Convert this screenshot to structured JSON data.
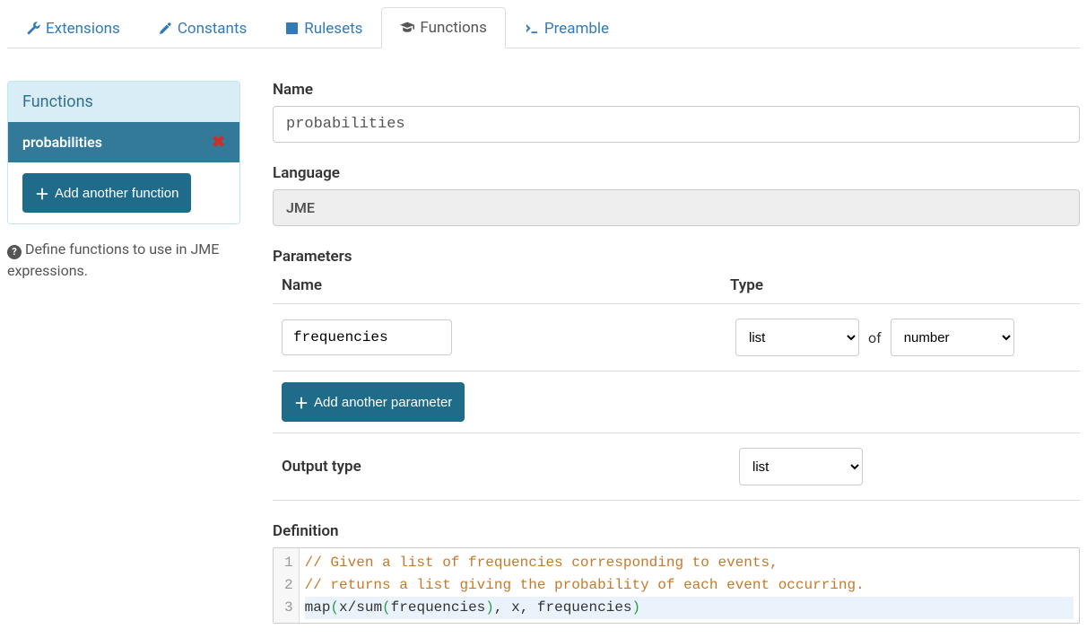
{
  "tabs": {
    "extensions": "Extensions",
    "constants": "Constants",
    "rulesets": "Rulesets",
    "functions": "Functions",
    "preamble": "Preamble"
  },
  "sidebar": {
    "panel_title": "Functions",
    "items": [
      {
        "name": "probabilities"
      }
    ],
    "add_button": "Add another function",
    "help_text": "Define functions to use in JME expressions."
  },
  "form": {
    "name_label": "Name",
    "name_value": "probabilities",
    "language_label": "Language",
    "language_value": "JME",
    "parameters_label": "Parameters",
    "param_header_name": "Name",
    "param_header_type": "Type",
    "parameters": [
      {
        "name": "frequencies",
        "type": "list",
        "of_word": "of",
        "subtype": "number"
      }
    ],
    "add_param_button": "Add another parameter",
    "output_type_label": "Output type",
    "output_type_value": "list",
    "definition_label": "Definition",
    "code": {
      "line1": "// Given a list of frequencies corresponding to events,",
      "line2": "// returns a list giving the probability of each event occurring.",
      "line3": {
        "t1": "map",
        "p1": "(",
        "t2": "x/sum",
        "p2": "(",
        "t3": "frequencies",
        "p3": ")",
        "t4": ", x, frequencies",
        "p4": ")"
      },
      "gutter": [
        "1",
        "2",
        "3"
      ]
    }
  }
}
